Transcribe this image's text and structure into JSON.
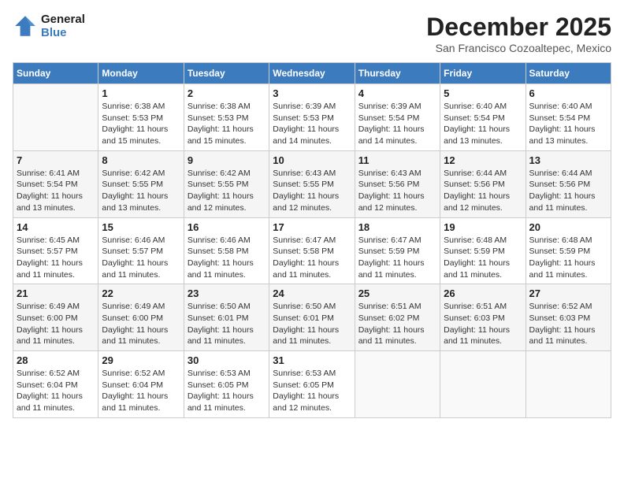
{
  "header": {
    "logo_line1": "General",
    "logo_line2": "Blue",
    "month": "December 2025",
    "location": "San Francisco Cozoaltepec, Mexico"
  },
  "weekdays": [
    "Sunday",
    "Monday",
    "Tuesday",
    "Wednesday",
    "Thursday",
    "Friday",
    "Saturday"
  ],
  "weeks": [
    [
      {
        "day": "",
        "sunrise": "",
        "sunset": "",
        "daylight": ""
      },
      {
        "day": "1",
        "sunrise": "Sunrise: 6:38 AM",
        "sunset": "Sunset: 5:53 PM",
        "daylight": "Daylight: 11 hours and 15 minutes."
      },
      {
        "day": "2",
        "sunrise": "Sunrise: 6:38 AM",
        "sunset": "Sunset: 5:53 PM",
        "daylight": "Daylight: 11 hours and 15 minutes."
      },
      {
        "day": "3",
        "sunrise": "Sunrise: 6:39 AM",
        "sunset": "Sunset: 5:53 PM",
        "daylight": "Daylight: 11 hours and 14 minutes."
      },
      {
        "day": "4",
        "sunrise": "Sunrise: 6:39 AM",
        "sunset": "Sunset: 5:54 PM",
        "daylight": "Daylight: 11 hours and 14 minutes."
      },
      {
        "day": "5",
        "sunrise": "Sunrise: 6:40 AM",
        "sunset": "Sunset: 5:54 PM",
        "daylight": "Daylight: 11 hours and 13 minutes."
      },
      {
        "day": "6",
        "sunrise": "Sunrise: 6:40 AM",
        "sunset": "Sunset: 5:54 PM",
        "daylight": "Daylight: 11 hours and 13 minutes."
      }
    ],
    [
      {
        "day": "7",
        "sunrise": "Sunrise: 6:41 AM",
        "sunset": "Sunset: 5:54 PM",
        "daylight": "Daylight: 11 hours and 13 minutes."
      },
      {
        "day": "8",
        "sunrise": "Sunrise: 6:42 AM",
        "sunset": "Sunset: 5:55 PM",
        "daylight": "Daylight: 11 hours and 13 minutes."
      },
      {
        "day": "9",
        "sunrise": "Sunrise: 6:42 AM",
        "sunset": "Sunset: 5:55 PM",
        "daylight": "Daylight: 11 hours and 12 minutes."
      },
      {
        "day": "10",
        "sunrise": "Sunrise: 6:43 AM",
        "sunset": "Sunset: 5:55 PM",
        "daylight": "Daylight: 11 hours and 12 minutes."
      },
      {
        "day": "11",
        "sunrise": "Sunrise: 6:43 AM",
        "sunset": "Sunset: 5:56 PM",
        "daylight": "Daylight: 11 hours and 12 minutes."
      },
      {
        "day": "12",
        "sunrise": "Sunrise: 6:44 AM",
        "sunset": "Sunset: 5:56 PM",
        "daylight": "Daylight: 11 hours and 12 minutes."
      },
      {
        "day": "13",
        "sunrise": "Sunrise: 6:44 AM",
        "sunset": "Sunset: 5:56 PM",
        "daylight": "Daylight: 11 hours and 11 minutes."
      }
    ],
    [
      {
        "day": "14",
        "sunrise": "Sunrise: 6:45 AM",
        "sunset": "Sunset: 5:57 PM",
        "daylight": "Daylight: 11 hours and 11 minutes."
      },
      {
        "day": "15",
        "sunrise": "Sunrise: 6:46 AM",
        "sunset": "Sunset: 5:57 PM",
        "daylight": "Daylight: 11 hours and 11 minutes."
      },
      {
        "day": "16",
        "sunrise": "Sunrise: 6:46 AM",
        "sunset": "Sunset: 5:58 PM",
        "daylight": "Daylight: 11 hours and 11 minutes."
      },
      {
        "day": "17",
        "sunrise": "Sunrise: 6:47 AM",
        "sunset": "Sunset: 5:58 PM",
        "daylight": "Daylight: 11 hours and 11 minutes."
      },
      {
        "day": "18",
        "sunrise": "Sunrise: 6:47 AM",
        "sunset": "Sunset: 5:59 PM",
        "daylight": "Daylight: 11 hours and 11 minutes."
      },
      {
        "day": "19",
        "sunrise": "Sunrise: 6:48 AM",
        "sunset": "Sunset: 5:59 PM",
        "daylight": "Daylight: 11 hours and 11 minutes."
      },
      {
        "day": "20",
        "sunrise": "Sunrise: 6:48 AM",
        "sunset": "Sunset: 5:59 PM",
        "daylight": "Daylight: 11 hours and 11 minutes."
      }
    ],
    [
      {
        "day": "21",
        "sunrise": "Sunrise: 6:49 AM",
        "sunset": "Sunset: 6:00 PM",
        "daylight": "Daylight: 11 hours and 11 minutes."
      },
      {
        "day": "22",
        "sunrise": "Sunrise: 6:49 AM",
        "sunset": "Sunset: 6:00 PM",
        "daylight": "Daylight: 11 hours and 11 minutes."
      },
      {
        "day": "23",
        "sunrise": "Sunrise: 6:50 AM",
        "sunset": "Sunset: 6:01 PM",
        "daylight": "Daylight: 11 hours and 11 minutes."
      },
      {
        "day": "24",
        "sunrise": "Sunrise: 6:50 AM",
        "sunset": "Sunset: 6:01 PM",
        "daylight": "Daylight: 11 hours and 11 minutes."
      },
      {
        "day": "25",
        "sunrise": "Sunrise: 6:51 AM",
        "sunset": "Sunset: 6:02 PM",
        "daylight": "Daylight: 11 hours and 11 minutes."
      },
      {
        "day": "26",
        "sunrise": "Sunrise: 6:51 AM",
        "sunset": "Sunset: 6:03 PM",
        "daylight": "Daylight: 11 hours and 11 minutes."
      },
      {
        "day": "27",
        "sunrise": "Sunrise: 6:52 AM",
        "sunset": "Sunset: 6:03 PM",
        "daylight": "Daylight: 11 hours and 11 minutes."
      }
    ],
    [
      {
        "day": "28",
        "sunrise": "Sunrise: 6:52 AM",
        "sunset": "Sunset: 6:04 PM",
        "daylight": "Daylight: 11 hours and 11 minutes."
      },
      {
        "day": "29",
        "sunrise": "Sunrise: 6:52 AM",
        "sunset": "Sunset: 6:04 PM",
        "daylight": "Daylight: 11 hours and 11 minutes."
      },
      {
        "day": "30",
        "sunrise": "Sunrise: 6:53 AM",
        "sunset": "Sunset: 6:05 PM",
        "daylight": "Daylight: 11 hours and 11 minutes."
      },
      {
        "day": "31",
        "sunrise": "Sunrise: 6:53 AM",
        "sunset": "Sunset: 6:05 PM",
        "daylight": "Daylight: 11 hours and 12 minutes."
      },
      {
        "day": "",
        "sunrise": "",
        "sunset": "",
        "daylight": ""
      },
      {
        "day": "",
        "sunrise": "",
        "sunset": "",
        "daylight": ""
      },
      {
        "day": "",
        "sunrise": "",
        "sunset": "",
        "daylight": ""
      }
    ]
  ]
}
